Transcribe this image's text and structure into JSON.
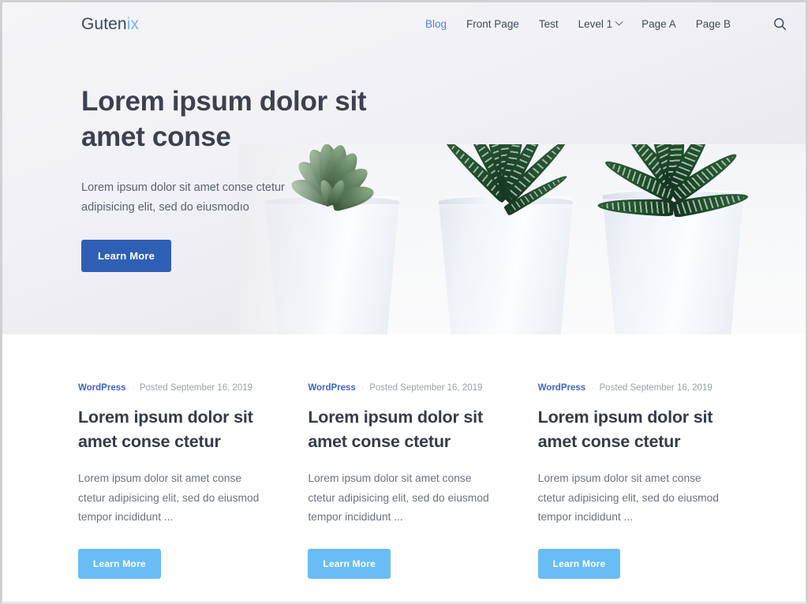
{
  "site": {
    "logo_primary": "Guten",
    "logo_accent": "ix",
    "accent_color": "#73b6ef",
    "brand_dark": "#39466b"
  },
  "nav": {
    "items": [
      {
        "label": "Blog",
        "active": true,
        "has_dropdown": false
      },
      {
        "label": "Front Page",
        "active": false,
        "has_dropdown": false
      },
      {
        "label": "Test",
        "active": false,
        "has_dropdown": false
      },
      {
        "label": "Level 1",
        "active": false,
        "has_dropdown": true
      },
      {
        "label": "Page A",
        "active": false,
        "has_dropdown": false
      },
      {
        "label": "Page B",
        "active": false,
        "has_dropdown": false
      }
    ],
    "search_icon": "search-icon"
  },
  "hero": {
    "title": "Lorem ipsum dolor sit amet conse",
    "subtitle": "Lorem ipsum dolor sit amet conse ctetur adipisicing elit, sed do eiusmodıo",
    "button_label": "Learn More",
    "button_color": "#2f5fb5",
    "image_alt": "three-succulent-plants-in-white-pots"
  },
  "posts": [
    {
      "category": "WordPress",
      "separator": "·",
      "date": "Posted September 16, 2019",
      "title": "Lorem ipsum dolor sit amet conse ctetur",
      "excerpt": "Lorem ipsum dolor sit amet conse ctetur adipisicing elit, sed do eiusmod tempor incididunt ...",
      "button_label": "Learn More",
      "button_color": "#69bdf4"
    },
    {
      "category": "WordPress",
      "separator": "·",
      "date": "Posted September 16, 2019",
      "title": "Lorem ipsum dolor sit amet conse ctetur",
      "excerpt": "Lorem ipsum dolor sit amet conse ctetur adipisicing elit, sed do eiusmod tempor incididunt ...",
      "button_label": "Learn More",
      "button_color": "#69bdf4"
    },
    {
      "category": "WordPress",
      "separator": "·",
      "date": "Posted September 16, 2019",
      "title": "Lorem ipsum dolor sit amet conse ctetur",
      "excerpt": "Lorem ipsum dolor sit amet conse ctetur adipisicing elit, sed do eiusmod tempor incididunt ...",
      "button_label": "Learn More",
      "button_color": "#69bdf4"
    }
  ]
}
